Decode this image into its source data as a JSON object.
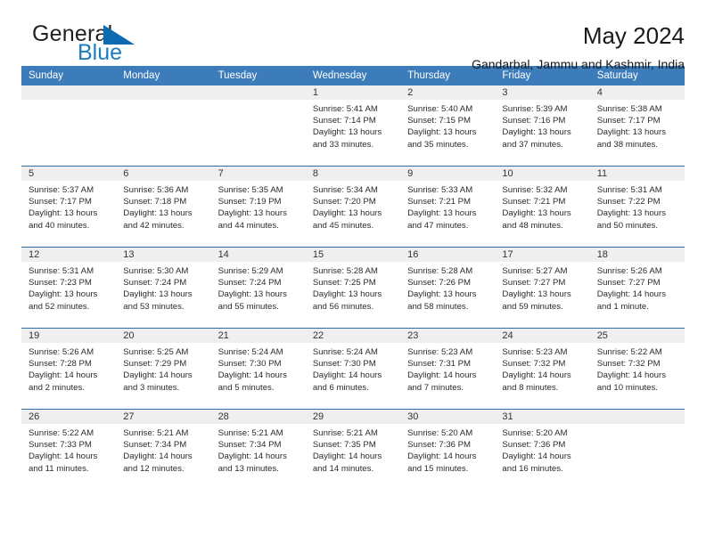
{
  "brand": {
    "logo_primary": "General",
    "logo_secondary": "Blue",
    "logo_icon": "blue-triangle",
    "accent_color": "#0b6ab0",
    "header_color": "#3c7cba"
  },
  "header": {
    "title": "May 2024",
    "subtitle": "Gandarbal, Jammu and Kashmir, India"
  },
  "calendar": {
    "weekday_headers": [
      "Sunday",
      "Monday",
      "Tuesday",
      "Wednesday",
      "Thursday",
      "Friday",
      "Saturday"
    ],
    "weeks": [
      [
        {
          "day": "",
          "lines": []
        },
        {
          "day": "",
          "lines": []
        },
        {
          "day": "",
          "lines": []
        },
        {
          "day": "1",
          "lines": [
            "Sunrise: 5:41 AM",
            "Sunset: 7:14 PM",
            "Daylight: 13 hours",
            "and 33 minutes."
          ]
        },
        {
          "day": "2",
          "lines": [
            "Sunrise: 5:40 AM",
            "Sunset: 7:15 PM",
            "Daylight: 13 hours",
            "and 35 minutes."
          ]
        },
        {
          "day": "3",
          "lines": [
            "Sunrise: 5:39 AM",
            "Sunset: 7:16 PM",
            "Daylight: 13 hours",
            "and 37 minutes."
          ]
        },
        {
          "day": "4",
          "lines": [
            "Sunrise: 5:38 AM",
            "Sunset: 7:17 PM",
            "Daylight: 13 hours",
            "and 38 minutes."
          ]
        }
      ],
      [
        {
          "day": "5",
          "lines": [
            "Sunrise: 5:37 AM",
            "Sunset: 7:17 PM",
            "Daylight: 13 hours",
            "and 40 minutes."
          ]
        },
        {
          "day": "6",
          "lines": [
            "Sunrise: 5:36 AM",
            "Sunset: 7:18 PM",
            "Daylight: 13 hours",
            "and 42 minutes."
          ]
        },
        {
          "day": "7",
          "lines": [
            "Sunrise: 5:35 AM",
            "Sunset: 7:19 PM",
            "Daylight: 13 hours",
            "and 44 minutes."
          ]
        },
        {
          "day": "8",
          "lines": [
            "Sunrise: 5:34 AM",
            "Sunset: 7:20 PM",
            "Daylight: 13 hours",
            "and 45 minutes."
          ]
        },
        {
          "day": "9",
          "lines": [
            "Sunrise: 5:33 AM",
            "Sunset: 7:21 PM",
            "Daylight: 13 hours",
            "and 47 minutes."
          ]
        },
        {
          "day": "10",
          "lines": [
            "Sunrise: 5:32 AM",
            "Sunset: 7:21 PM",
            "Daylight: 13 hours",
            "and 48 minutes."
          ]
        },
        {
          "day": "11",
          "lines": [
            "Sunrise: 5:31 AM",
            "Sunset: 7:22 PM",
            "Daylight: 13 hours",
            "and 50 minutes."
          ]
        }
      ],
      [
        {
          "day": "12",
          "lines": [
            "Sunrise: 5:31 AM",
            "Sunset: 7:23 PM",
            "Daylight: 13 hours",
            "and 52 minutes."
          ]
        },
        {
          "day": "13",
          "lines": [
            "Sunrise: 5:30 AM",
            "Sunset: 7:24 PM",
            "Daylight: 13 hours",
            "and 53 minutes."
          ]
        },
        {
          "day": "14",
          "lines": [
            "Sunrise: 5:29 AM",
            "Sunset: 7:24 PM",
            "Daylight: 13 hours",
            "and 55 minutes."
          ]
        },
        {
          "day": "15",
          "lines": [
            "Sunrise: 5:28 AM",
            "Sunset: 7:25 PM",
            "Daylight: 13 hours",
            "and 56 minutes."
          ]
        },
        {
          "day": "16",
          "lines": [
            "Sunrise: 5:28 AM",
            "Sunset: 7:26 PM",
            "Daylight: 13 hours",
            "and 58 minutes."
          ]
        },
        {
          "day": "17",
          "lines": [
            "Sunrise: 5:27 AM",
            "Sunset: 7:27 PM",
            "Daylight: 13 hours",
            "and 59 minutes."
          ]
        },
        {
          "day": "18",
          "lines": [
            "Sunrise: 5:26 AM",
            "Sunset: 7:27 PM",
            "Daylight: 14 hours",
            "and 1 minute."
          ]
        }
      ],
      [
        {
          "day": "19",
          "lines": [
            "Sunrise: 5:26 AM",
            "Sunset: 7:28 PM",
            "Daylight: 14 hours",
            "and 2 minutes."
          ]
        },
        {
          "day": "20",
          "lines": [
            "Sunrise: 5:25 AM",
            "Sunset: 7:29 PM",
            "Daylight: 14 hours",
            "and 3 minutes."
          ]
        },
        {
          "day": "21",
          "lines": [
            "Sunrise: 5:24 AM",
            "Sunset: 7:30 PM",
            "Daylight: 14 hours",
            "and 5 minutes."
          ]
        },
        {
          "day": "22",
          "lines": [
            "Sunrise: 5:24 AM",
            "Sunset: 7:30 PM",
            "Daylight: 14 hours",
            "and 6 minutes."
          ]
        },
        {
          "day": "23",
          "lines": [
            "Sunrise: 5:23 AM",
            "Sunset: 7:31 PM",
            "Daylight: 14 hours",
            "and 7 minutes."
          ]
        },
        {
          "day": "24",
          "lines": [
            "Sunrise: 5:23 AM",
            "Sunset: 7:32 PM",
            "Daylight: 14 hours",
            "and 8 minutes."
          ]
        },
        {
          "day": "25",
          "lines": [
            "Sunrise: 5:22 AM",
            "Sunset: 7:32 PM",
            "Daylight: 14 hours",
            "and 10 minutes."
          ]
        }
      ],
      [
        {
          "day": "26",
          "lines": [
            "Sunrise: 5:22 AM",
            "Sunset: 7:33 PM",
            "Daylight: 14 hours",
            "and 11 minutes."
          ]
        },
        {
          "day": "27",
          "lines": [
            "Sunrise: 5:21 AM",
            "Sunset: 7:34 PM",
            "Daylight: 14 hours",
            "and 12 minutes."
          ]
        },
        {
          "day": "28",
          "lines": [
            "Sunrise: 5:21 AM",
            "Sunset: 7:34 PM",
            "Daylight: 14 hours",
            "and 13 minutes."
          ]
        },
        {
          "day": "29",
          "lines": [
            "Sunrise: 5:21 AM",
            "Sunset: 7:35 PM",
            "Daylight: 14 hours",
            "and 14 minutes."
          ]
        },
        {
          "day": "30",
          "lines": [
            "Sunrise: 5:20 AM",
            "Sunset: 7:36 PM",
            "Daylight: 14 hours",
            "and 15 minutes."
          ]
        },
        {
          "day": "31",
          "lines": [
            "Sunrise: 5:20 AM",
            "Sunset: 7:36 PM",
            "Daylight: 14 hours",
            "and 16 minutes."
          ]
        },
        {
          "day": "",
          "lines": []
        }
      ]
    ]
  }
}
